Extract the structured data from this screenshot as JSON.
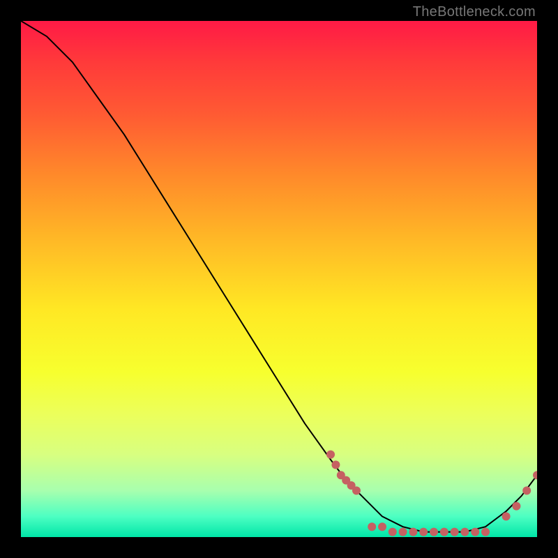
{
  "domain": "Chart",
  "watermark": "TheBottleneck.com",
  "colors": {
    "dot": "#c56162",
    "curve": "#000000",
    "background_black": "#000000"
  },
  "chart_data": {
    "type": "line",
    "title": "",
    "xlabel": "",
    "ylabel": "",
    "xlim": [
      0,
      100
    ],
    "ylim": [
      0,
      100
    ],
    "grid": false,
    "legend": false,
    "series": [
      {
        "name": "curve",
        "x": [
          0,
          5,
          10,
          15,
          20,
          25,
          30,
          35,
          40,
          45,
          50,
          55,
          60,
          63,
          66,
          70,
          74,
          78,
          82,
          86,
          90,
          94,
          97,
          100
        ],
        "y": [
          100,
          97,
          92,
          85,
          78,
          70,
          62,
          54,
          46,
          38,
          30,
          22,
          15,
          11,
          8,
          4,
          2,
          1,
          1,
          1,
          2,
          5,
          8,
          12
        ]
      }
    ],
    "points_highlight": [
      {
        "name": "cluster_left_slope",
        "x": 60,
        "y": 16
      },
      {
        "name": "cluster_left_slope",
        "x": 61,
        "y": 14
      },
      {
        "name": "cluster_left_slope",
        "x": 62,
        "y": 12
      },
      {
        "name": "cluster_left_slope",
        "x": 63,
        "y": 11
      },
      {
        "name": "cluster_left_slope",
        "x": 64,
        "y": 10
      },
      {
        "name": "cluster_left_slope",
        "x": 65,
        "y": 9
      },
      {
        "name": "bottom_band",
        "x": 68,
        "y": 2
      },
      {
        "name": "bottom_band",
        "x": 70,
        "y": 2
      },
      {
        "name": "bottom_band",
        "x": 72,
        "y": 1
      },
      {
        "name": "bottom_band",
        "x": 74,
        "y": 1
      },
      {
        "name": "bottom_band",
        "x": 76,
        "y": 1
      },
      {
        "name": "bottom_band",
        "x": 78,
        "y": 1
      },
      {
        "name": "bottom_band",
        "x": 80,
        "y": 1
      },
      {
        "name": "bottom_band",
        "x": 82,
        "y": 1
      },
      {
        "name": "bottom_band",
        "x": 84,
        "y": 1
      },
      {
        "name": "bottom_band",
        "x": 86,
        "y": 1
      },
      {
        "name": "bottom_band",
        "x": 88,
        "y": 1
      },
      {
        "name": "bottom_band",
        "x": 90,
        "y": 1
      },
      {
        "name": "right_rise",
        "x": 94,
        "y": 4
      },
      {
        "name": "right_rise",
        "x": 96,
        "y": 6
      },
      {
        "name": "right_rise",
        "x": 98,
        "y": 9
      },
      {
        "name": "right_rise",
        "x": 100,
        "y": 12
      }
    ]
  }
}
